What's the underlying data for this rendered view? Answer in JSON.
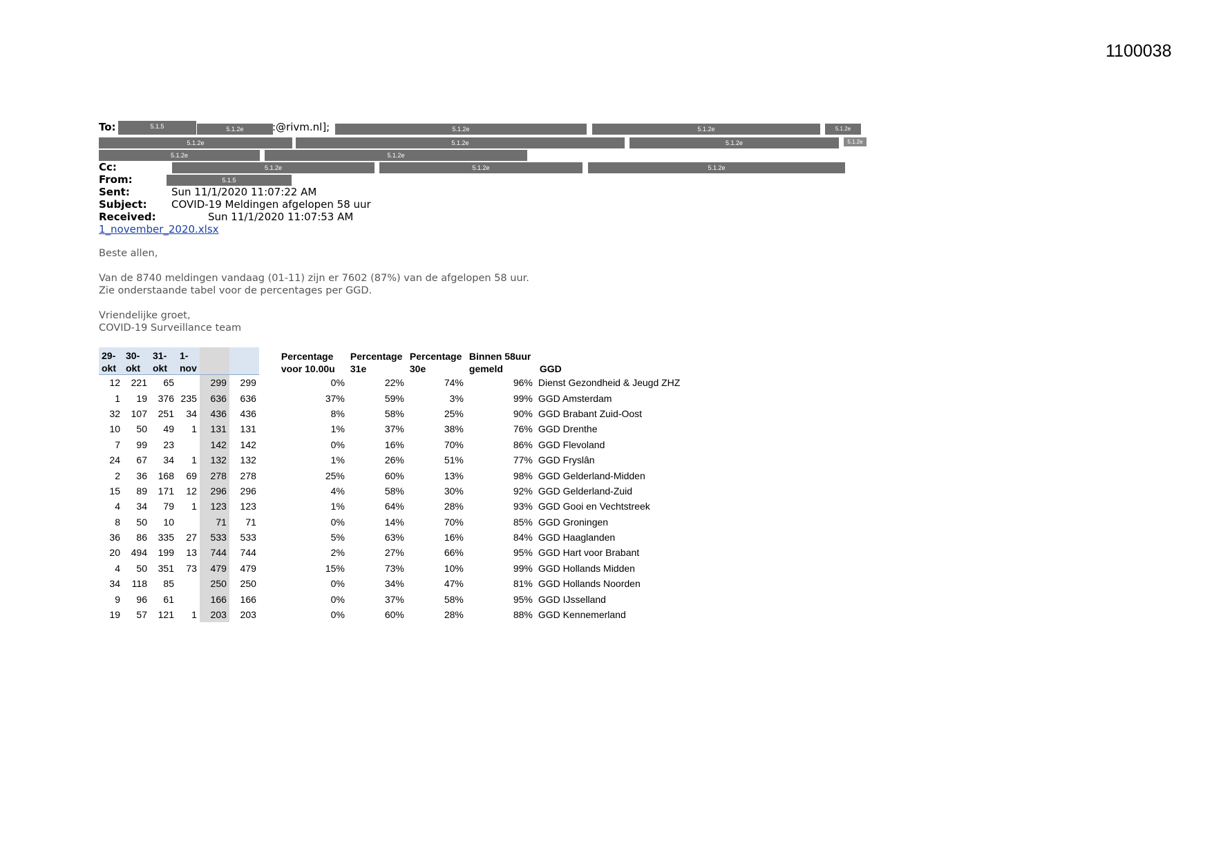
{
  "doc_number": "1100038",
  "email": {
    "to_label": "To:",
    "to_suffix": ":@rivm.nl];",
    "cc_label": "Cc:",
    "from_label": "From:",
    "sent_label": "Sent:",
    "sent_value": "Sun 11/1/2020 11:07:22 AM",
    "subject_label": "Subject:",
    "subject_value": "COVID-19 Meldingen afgelopen 58 uur",
    "received_label": "Received:",
    "received_value": "Sun 11/1/2020 11:07:53 AM",
    "attachment": "1_november_2020.xlsx",
    "redaction_codes": {
      "personal": "5.1.5",
      "contact": "5.1.2e"
    }
  },
  "message": {
    "greeting": "Beste allen,",
    "line1": "Van de 8740 meldingen vandaag (01-11) zijn er 7602 (87%) van de afgelopen 58 uur.",
    "line2": "Zie onderstaande tabel voor de percentages per GGD.",
    "closing": "Vriendelijke groet,",
    "signature": "COVID-19 Surveillance team"
  },
  "table": {
    "headers": {
      "d1": [
        "29-",
        "okt"
      ],
      "d2": [
        "30-",
        "okt"
      ],
      "d3": [
        "31-",
        "okt"
      ],
      "d4": [
        "1-",
        "nov"
      ],
      "p1": [
        "Percentage",
        "voor 10.00u"
      ],
      "p2": [
        "Percentage",
        "31e"
      ],
      "p3": [
        "Percentage",
        "30e"
      ],
      "p4": [
        "Binnen 58uur",
        "gemeld"
      ],
      "ggd": "GGD"
    },
    "rows": [
      [
        "12",
        "221",
        "65",
        "",
        "299",
        "299",
        "0%",
        "22%",
        "74%",
        "96%",
        "Dienst Gezondheid & Jeugd ZHZ"
      ],
      [
        "1",
        "19",
        "376",
        "235",
        "636",
        "636",
        "37%",
        "59%",
        "3%",
        "99%",
        "GGD Amsterdam"
      ],
      [
        "32",
        "107",
        "251",
        "34",
        "436",
        "436",
        "8%",
        "58%",
        "25%",
        "90%",
        "GGD Brabant Zuid-Oost"
      ],
      [
        "10",
        "50",
        "49",
        "1",
        "131",
        "131",
        "1%",
        "37%",
        "38%",
        "76%",
        "GGD Drenthe"
      ],
      [
        "7",
        "99",
        "23",
        "",
        "142",
        "142",
        "0%",
        "16%",
        "70%",
        "86%",
        "GGD Flevoland"
      ],
      [
        "24",
        "67",
        "34",
        "1",
        "132",
        "132",
        "1%",
        "26%",
        "51%",
        "77%",
        "GGD Fryslân"
      ],
      [
        "2",
        "36",
        "168",
        "69",
        "278",
        "278",
        "25%",
        "60%",
        "13%",
        "98%",
        "GGD Gelderland-Midden"
      ],
      [
        "15",
        "89",
        "171",
        "12",
        "296",
        "296",
        "4%",
        "58%",
        "30%",
        "92%",
        "GGD Gelderland-Zuid"
      ],
      [
        "4",
        "34",
        "79",
        "1",
        "123",
        "123",
        "1%",
        "64%",
        "28%",
        "93%",
        "GGD Gooi en Vechtstreek"
      ],
      [
        "8",
        "50",
        "10",
        "",
        "71",
        "71",
        "0%",
        "14%",
        "70%",
        "85%",
        "GGD Groningen"
      ],
      [
        "36",
        "86",
        "335",
        "27",
        "533",
        "533",
        "5%",
        "63%",
        "16%",
        "84%",
        "GGD Haaglanden"
      ],
      [
        "20",
        "494",
        "199",
        "13",
        "744",
        "744",
        "2%",
        "27%",
        "66%",
        "95%",
        "GGD Hart voor Brabant"
      ],
      [
        "4",
        "50",
        "351",
        "73",
        "479",
        "479",
        "15%",
        "73%",
        "10%",
        "99%",
        "GGD Hollands Midden"
      ],
      [
        "34",
        "118",
        "85",
        "",
        "250",
        "250",
        "0%",
        "34%",
        "47%",
        "81%",
        "GGD Hollands Noorden"
      ],
      [
        "9",
        "96",
        "61",
        "",
        "166",
        "166",
        "0%",
        "37%",
        "58%",
        "95%",
        "GGD IJsselland"
      ],
      [
        "19",
        "57",
        "121",
        "1",
        "203",
        "203",
        "0%",
        "60%",
        "28%",
        "88%",
        "GGD Kennemerland"
      ]
    ]
  }
}
